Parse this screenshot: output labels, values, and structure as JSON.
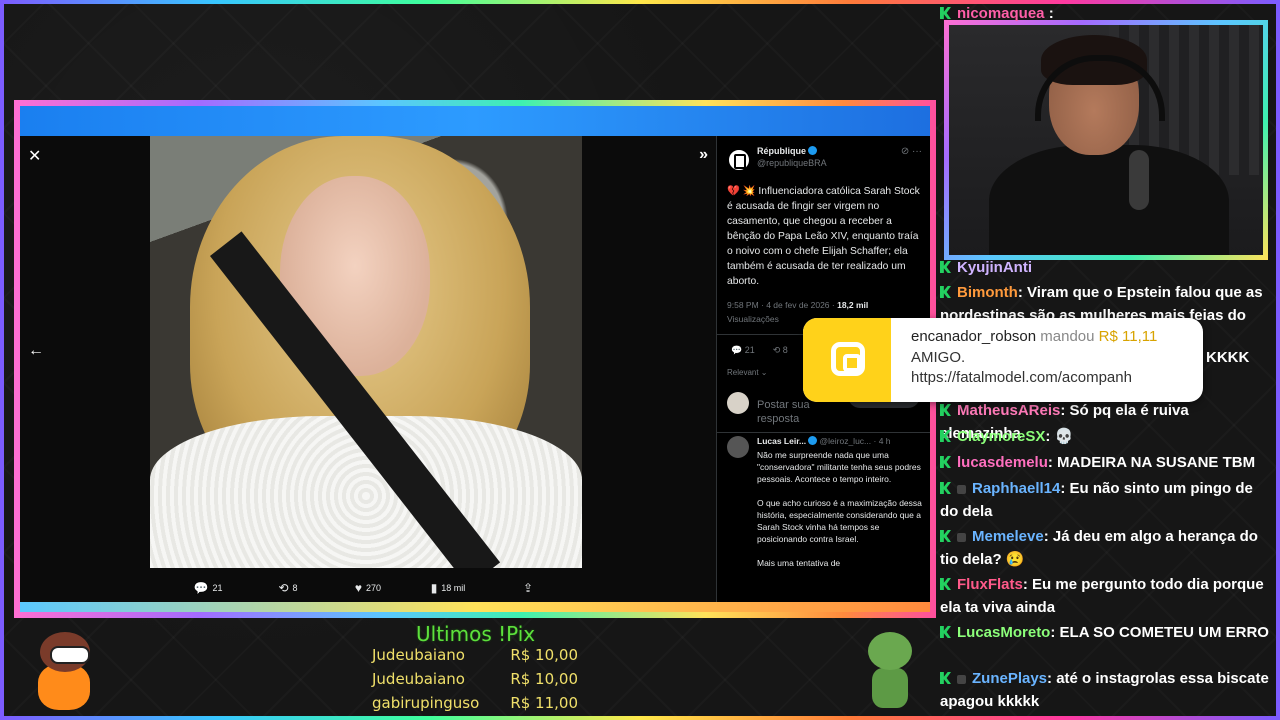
{
  "tweet": {
    "author_name": "République",
    "author_handle": "@republiqueBRA",
    "header_icons": "⊘ ···",
    "body": "💔 💥 Influenciadora católica Sarah Stock é acusada de fingir ser virgem no casamento, que chegou a receber a bênção do Papa Leão XIV, enquanto traía o noivo com o chefe Elijah Schaffer; ela também é acusada de ter realizado um aborto.",
    "timestamp": "9:58 PM · 4 de fev de 2026 · ",
    "views_value": "18,2 mil",
    "views_label": "Visualizações",
    "stat_replies": "21",
    "stat_reposts": "8",
    "sort_label": "Relevant ⌄",
    "reply_placeholder": "Postar sua resposta"
  },
  "lightbox": {
    "close": "✕",
    "back": "←",
    "collapse": "»",
    "replies": "21",
    "reposts": "8",
    "likes": "270",
    "views": "18 mil"
  },
  "comment": {
    "name": "Lucas Leir...",
    "handle": "@leiroz_luc... · 4 h",
    "text": "Não me surpreende nada que uma \"conservadora\" militante tenha seus podres pessoais. Acontece o tempo inteiro.\n\nO que acho curioso é a maximização dessa história, especialmente considerando que a Sarah Stock vinha há tempos se posicionando contra Israel.\n\nMais uma tentativa de"
  },
  "donation": {
    "who": "encanador_robson",
    "verb": "mandou",
    "amount": "R$ 11,11",
    "line2": "AMIGO.",
    "line3": "https://fatalmodel.com/acompanh"
  },
  "chat": [
    {
      "user": "nicomaquea",
      "text": " : ",
      "color": "#ff5fa8"
    },
    {
      "user": "KyujinAnti",
      "text": " ",
      "color": "#d0b4ff"
    },
    {
      "user": "Bimonth",
      "text": ": Viram que o Epstein falou que as nordestinas são as mulheres mais feias do",
      "color": "#ff9a3c"
    },
    {
      "user": "",
      "text": "KKKK",
      "color": "#ffffff"
    },
    {
      "user": "MatheusAReis",
      "text": ": Só pq ela é ruiva alemazinha",
      "color": "#ff7ab8"
    },
    {
      "user": "ClaymoreSX",
      "text": ": 💀",
      "color": "#8cff7a"
    },
    {
      "user": "lucasdemelu",
      "text": ": MADEIRA NA SUSANE TBM",
      "color": "#ff6fbf"
    },
    {
      "user": "Raphhaell14",
      "text": ": Eu não sinto um pingo de do dela",
      "color": "#6ab4ff"
    },
    {
      "user": "Memeleve",
      "text": ": Já deu em algo a herança do tio dela? 😢",
      "color": "#6ab4ff"
    },
    {
      "user": "FluxFlats",
      "text": ": Eu me pergunto todo dia porque ela ta viva ainda",
      "color": "#ff5a8a"
    },
    {
      "user": "LucasMoreto",
      "text": ": ELA SO COMETEU UM ERRO",
      "color": "#8cff7a"
    },
    {
      "user": "ZunePlays",
      "text": ": até o instagrolas essa biscate apagou kkkkk",
      "color": "#6ab4ff"
    }
  ],
  "pix": {
    "title": "Ultimos !Pix",
    "rows": [
      {
        "name": "Judeubaiano",
        "amount": "R$ 10,00"
      },
      {
        "name": "Judeubaiano",
        "amount": "R$ 10,00"
      },
      {
        "name": "gabirupinguso",
        "amount": "R$ 11,00"
      }
    ]
  },
  "colors": {
    "chat_badge": "#23d160",
    "pix_title": "#5de03c",
    "pix_text": "#f0e06a",
    "donation_accent": "#ffd21a",
    "verified": "#1d9bf0"
  }
}
